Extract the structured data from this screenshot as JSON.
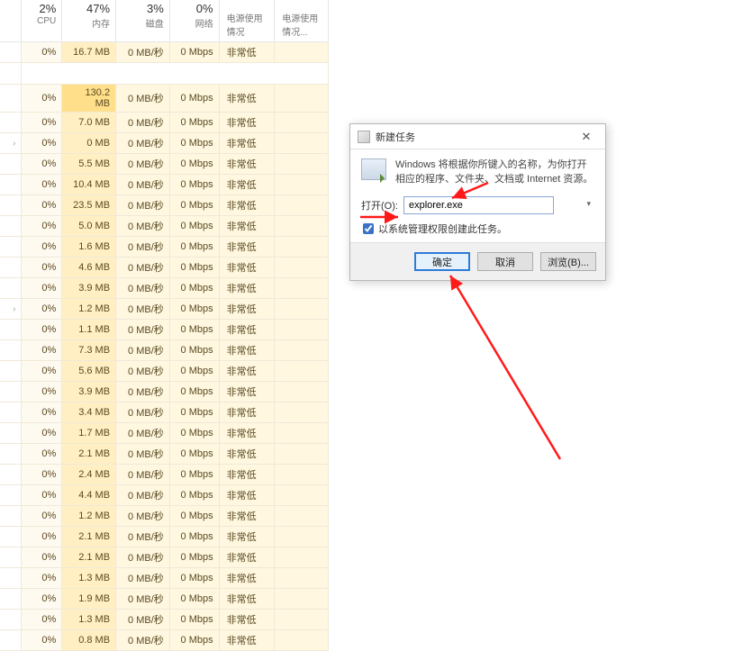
{
  "columns": {
    "cpu": {
      "pct": "2%",
      "label": "CPU"
    },
    "mem": {
      "pct": "47%",
      "label": "内存"
    },
    "disk": {
      "pct": "3%",
      "label": "磁盘"
    },
    "net": {
      "pct": "0%",
      "label": "网络"
    },
    "power": {
      "label": "电源使用情况"
    },
    "power2": {
      "label": "电源使用情况..."
    }
  },
  "rows": [
    {
      "cpu": "0%",
      "mem": "16.7 MB",
      "memHi": false,
      "disk": "0 MB/秒",
      "net": "0 Mbps",
      "power": "非常低",
      "chevron": false,
      "spacerAfter": true
    },
    {
      "cpu": "0%",
      "mem": "130.2 MB",
      "memHi": true,
      "disk": "0 MB/秒",
      "net": "0 Mbps",
      "power": "非常低",
      "chevron": false
    },
    {
      "cpu": "0%",
      "mem": "7.0 MB",
      "memHi": false,
      "disk": "0 MB/秒",
      "net": "0 Mbps",
      "power": "非常低",
      "chevron": false
    },
    {
      "cpu": "0%",
      "mem": "0 MB",
      "memHi": false,
      "disk": "0 MB/秒",
      "net": "0 Mbps",
      "power": "非常低",
      "chevron": true
    },
    {
      "cpu": "0%",
      "mem": "5.5 MB",
      "memHi": false,
      "disk": "0 MB/秒",
      "net": "0 Mbps",
      "power": "非常低",
      "chevron": false
    },
    {
      "cpu": "0%",
      "mem": "10.4 MB",
      "memHi": false,
      "disk": "0 MB/秒",
      "net": "0 Mbps",
      "power": "非常低",
      "chevron": false
    },
    {
      "cpu": "0%",
      "mem": "23.5 MB",
      "memHi": false,
      "disk": "0 MB/秒",
      "net": "0 Mbps",
      "power": "非常低",
      "chevron": false
    },
    {
      "cpu": "0%",
      "mem": "5.0 MB",
      "memHi": false,
      "disk": "0 MB/秒",
      "net": "0 Mbps",
      "power": "非常低",
      "chevron": false
    },
    {
      "cpu": "0%",
      "mem": "1.6 MB",
      "memHi": false,
      "disk": "0 MB/秒",
      "net": "0 Mbps",
      "power": "非常低",
      "chevron": false
    },
    {
      "cpu": "0%",
      "mem": "4.6 MB",
      "memHi": false,
      "disk": "0 MB/秒",
      "net": "0 Mbps",
      "power": "非常低",
      "chevron": false
    },
    {
      "cpu": "0%",
      "mem": "3.9 MB",
      "memHi": false,
      "disk": "0 MB/秒",
      "net": "0 Mbps",
      "power": "非常低",
      "chevron": false
    },
    {
      "cpu": "0%",
      "mem": "1.2 MB",
      "memHi": false,
      "disk": "0 MB/秒",
      "net": "0 Mbps",
      "power": "非常低",
      "chevron": true
    },
    {
      "cpu": "0%",
      "mem": "1.1 MB",
      "memHi": false,
      "disk": "0 MB/秒",
      "net": "0 Mbps",
      "power": "非常低",
      "chevron": false
    },
    {
      "cpu": "0%",
      "mem": "7.3 MB",
      "memHi": false,
      "disk": "0 MB/秒",
      "net": "0 Mbps",
      "power": "非常低",
      "chevron": false
    },
    {
      "cpu": "0%",
      "mem": "5.6 MB",
      "memHi": false,
      "disk": "0 MB/秒",
      "net": "0 Mbps",
      "power": "非常低",
      "chevron": false
    },
    {
      "cpu": "0%",
      "mem": "3.9 MB",
      "memHi": false,
      "disk": "0 MB/秒",
      "net": "0 Mbps",
      "power": "非常低",
      "chevron": false
    },
    {
      "cpu": "0%",
      "mem": "3.4 MB",
      "memHi": false,
      "disk": "0 MB/秒",
      "net": "0 Mbps",
      "power": "非常低",
      "chevron": false
    },
    {
      "cpu": "0%",
      "mem": "1.7 MB",
      "memHi": false,
      "disk": "0 MB/秒",
      "net": "0 Mbps",
      "power": "非常低",
      "chevron": false
    },
    {
      "cpu": "0%",
      "mem": "2.1 MB",
      "memHi": false,
      "disk": "0 MB/秒",
      "net": "0 Mbps",
      "power": "非常低",
      "chevron": false
    },
    {
      "cpu": "0%",
      "mem": "2.4 MB",
      "memHi": false,
      "disk": "0 MB/秒",
      "net": "0 Mbps",
      "power": "非常低",
      "chevron": false
    },
    {
      "cpu": "0%",
      "mem": "4.4 MB",
      "memHi": false,
      "disk": "0 MB/秒",
      "net": "0 Mbps",
      "power": "非常低",
      "chevron": false
    },
    {
      "cpu": "0%",
      "mem": "1.2 MB",
      "memHi": false,
      "disk": "0 MB/秒",
      "net": "0 Mbps",
      "power": "非常低",
      "chevron": false
    },
    {
      "cpu": "0%",
      "mem": "2.1 MB",
      "memHi": false,
      "disk": "0 MB/秒",
      "net": "0 Mbps",
      "power": "非常低",
      "chevron": false
    },
    {
      "cpu": "0%",
      "mem": "2.1 MB",
      "memHi": false,
      "disk": "0 MB/秒",
      "net": "0 Mbps",
      "power": "非常低",
      "chevron": false
    },
    {
      "cpu": "0%",
      "mem": "1.3 MB",
      "memHi": false,
      "disk": "0 MB/秒",
      "net": "0 Mbps",
      "power": "非常低",
      "chevron": false
    },
    {
      "cpu": "0%",
      "mem": "1.9 MB",
      "memHi": false,
      "disk": "0 MB/秒",
      "net": "0 Mbps",
      "power": "非常低",
      "chevron": false
    },
    {
      "cpu": "0%",
      "mem": "1.3 MB",
      "memHi": false,
      "disk": "0 MB/秒",
      "net": "0 Mbps",
      "power": "非常低",
      "chevron": false
    },
    {
      "cpu": "0%",
      "mem": "0.8 MB",
      "memHi": false,
      "disk": "0 MB/秒",
      "net": "0 Mbps",
      "power": "非常低",
      "chevron": false
    }
  ],
  "dialog": {
    "title": "新建任务",
    "description": "Windows 将根据你所键入的名称，为你打开相应的程序、文件夹、文档或 Internet 资源。",
    "openLabel": "打开(O):",
    "openValue": "explorer.exe",
    "adminLabel": "以系统管理权限创建此任务。",
    "adminChecked": true,
    "buttons": {
      "ok": "确定",
      "cancel": "取消",
      "browse": "浏览(B)..."
    }
  }
}
